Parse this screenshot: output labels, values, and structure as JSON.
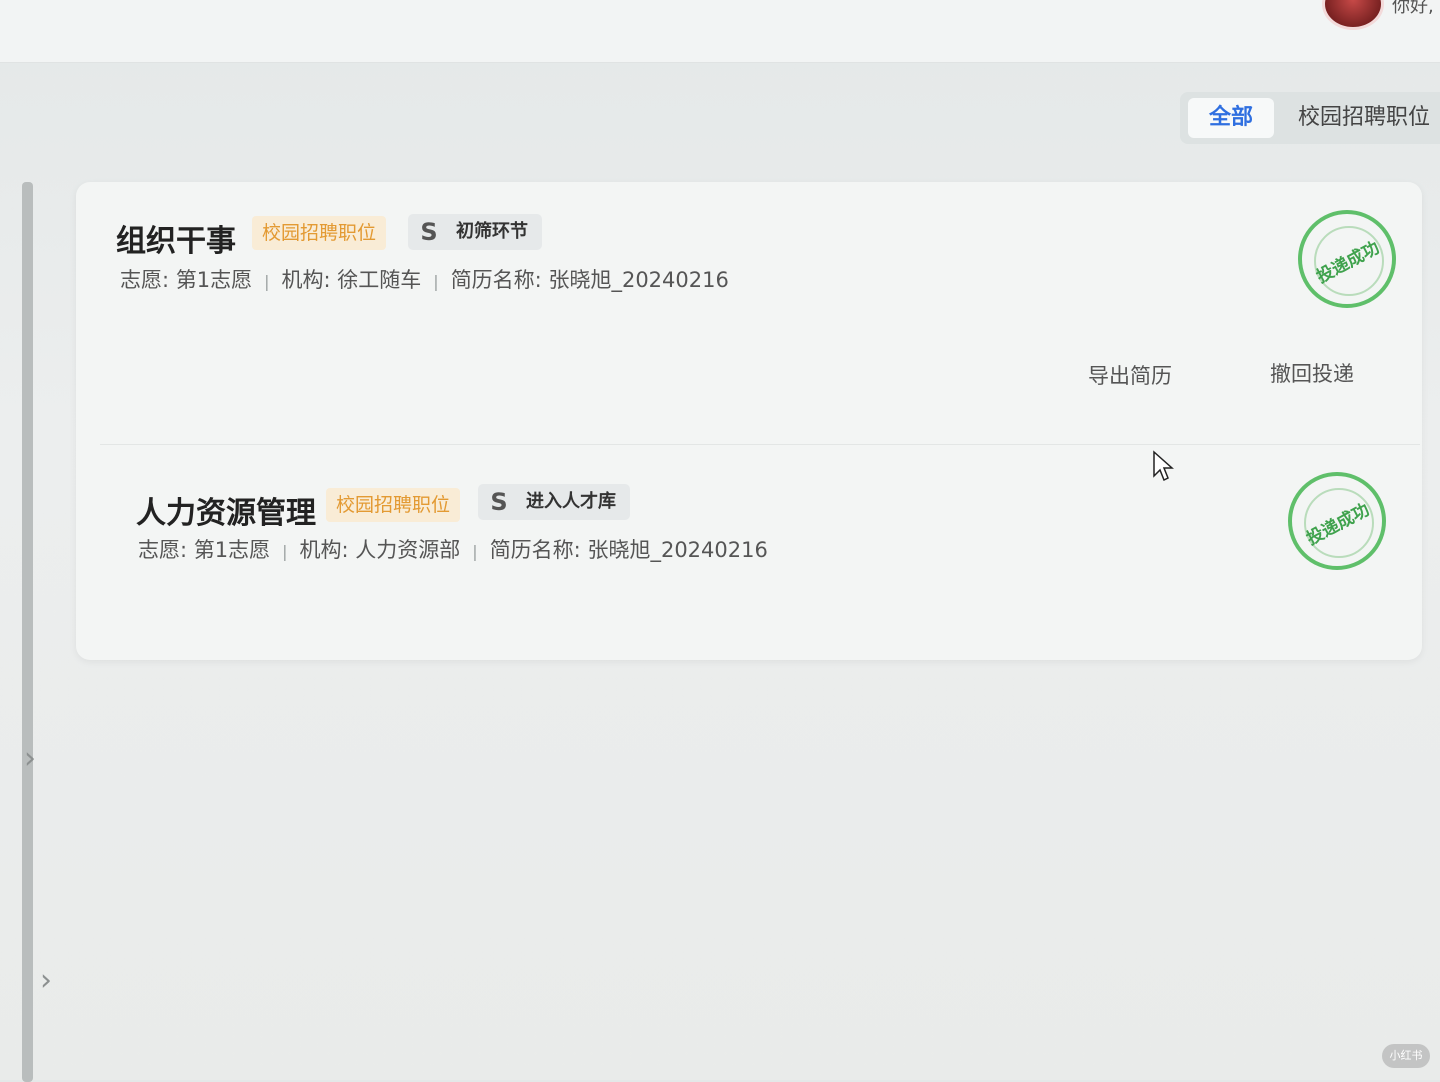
{
  "header": {
    "username": "你好,"
  },
  "filters": {
    "all_label": "全部",
    "campus_label": "校园招聘职位"
  },
  "applications": [
    {
      "title": "组织干事",
      "position_tag": "校园招聘职位",
      "stage_icon": "S",
      "stage": "初筛环节",
      "volunteer_label": "志愿:",
      "volunteer_value": "第1志愿",
      "org_label": "机构:",
      "org_value": "徐工随车",
      "resume_label": "简历名称:",
      "resume_value": "张晓旭_20240216",
      "stamp_text": "投递成功",
      "actions": {
        "export": "导出简历",
        "withdraw": "撤回投递"
      }
    },
    {
      "title": "人力资源管理",
      "position_tag": "校园招聘职位",
      "stage_icon": "S",
      "stage": "进入人才库",
      "volunteer_label": "志愿:",
      "volunteer_value": "第1志愿",
      "org_label": "机构:",
      "org_value": "人力资源部",
      "resume_label": "简历名称:",
      "resume_value": "张晓旭_20240216",
      "stamp_text": "投递成功"
    }
  ],
  "sidebar": {
    "chevron_icon": "chevron-right-icon"
  },
  "watermark": "小红书",
  "colors": {
    "accent_blue": "#2f6fe0",
    "tag_orange": "#e39a33",
    "stamp_green": "#3fa24d"
  }
}
